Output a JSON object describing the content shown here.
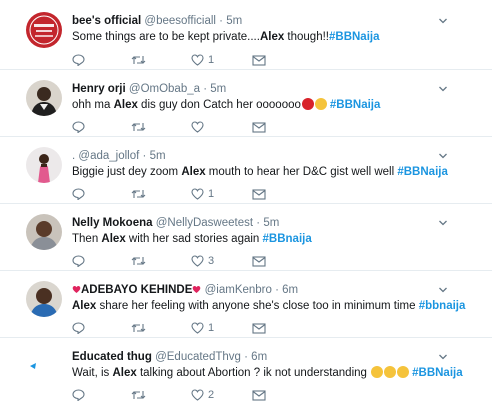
{
  "tweets": [
    {
      "name": "bee's official",
      "handle": "@beesofficiall",
      "time": "5m",
      "segments": [
        {
          "text": "Some things are to be kept private....",
          "style": "plain"
        },
        {
          "text": "Alex",
          "style": "bold"
        },
        {
          "text": " though!!",
          "style": "plain"
        },
        {
          "text": "#BBNaija",
          "style": "hashtag"
        }
      ],
      "likes": "1",
      "avatar_icon": "bees-logo-avatar"
    },
    {
      "name": "Henry orji",
      "handle": "@OmObab_a",
      "time": "5m",
      "segments": [
        {
          "text": "ohh ma ",
          "style": "plain"
        },
        {
          "text": "Alex",
          "style": "bold"
        },
        {
          "text": " dis guy don Catch her ooooooo",
          "style": "plain"
        },
        {
          "text": "#BBNaija",
          "style": "hashtag"
        }
      ],
      "likes": "",
      "avatar_icon": "profile-photo-avatar",
      "emojis": [
        "angry-face-emoji",
        "worried-face-emoji"
      ]
    },
    {
      "name": "",
      "handle": "@ada_jollof",
      "time": "5m",
      "segments": [
        {
          "text": "Biggie just dey zoom ",
          "style": "plain"
        },
        {
          "text": "Alex",
          "style": "bold"
        },
        {
          "text": " mouth to hear her D&C gist well well ",
          "style": "plain"
        },
        {
          "text": "#BBNaija",
          "style": "hashtag"
        }
      ],
      "likes": "1",
      "avatar_icon": "profile-photo-avatar"
    },
    {
      "name": "Nelly Mokoena",
      "handle": "@NellyDasweetest",
      "time": "5m",
      "segments": [
        {
          "text": "Then ",
          "style": "plain"
        },
        {
          "text": "Alex",
          "style": "bold"
        },
        {
          "text": " with her sad stories again ",
          "style": "plain"
        },
        {
          "text": "#BBnaija",
          "style": "hashtag"
        }
      ],
      "likes": "3",
      "avatar_icon": "profile-photo-avatar"
    },
    {
      "name": "ADEBAYO KEHINDE",
      "handle": "@iamKenbro",
      "time": "6m",
      "segments": [
        {
          "text": "Alex",
          "style": "bold"
        },
        {
          "text": " share her feeling with anyone she's close too in minimum time ",
          "style": "plain"
        },
        {
          "text": "#bbnaija",
          "style": "hashtag"
        }
      ],
      "likes": "1",
      "avatar_icon": "profile-photo-avatar"
    },
    {
      "name": "Educated thug",
      "handle": "@EducatedThvg",
      "time": "6m",
      "segments": [
        {
          "text": "Wait, is ",
          "style": "plain"
        },
        {
          "text": "Alex",
          "style": "bold"
        },
        {
          "text": " talking about Abortion ? ik not understanding ",
          "style": "plain"
        },
        {
          "text": "#BBNaija",
          "style": "hashtag"
        }
      ],
      "likes": "2",
      "avatar_icon": "blank-avatar",
      "emojis": [
        "sad-face-emoji",
        "sad-face-emoji",
        "sad-face-emoji"
      ]
    }
  ],
  "colors": {
    "hashtag": "#1b95e0",
    "secondary_text": "#657786",
    "divider": "#e6ecf0",
    "heart_red": "#e0245e"
  }
}
